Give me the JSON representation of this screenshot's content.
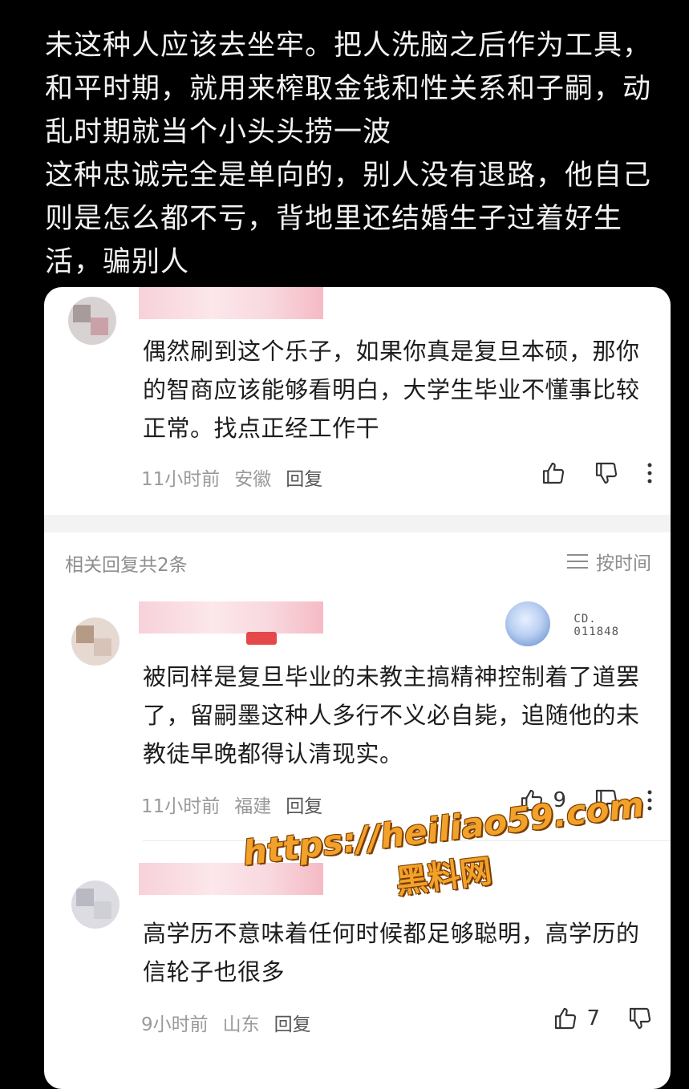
{
  "post": {
    "text": "未这种人应该去坐牢。把人洗脑之后作为工具，\n和平时期，就用来榨取金钱和性关系和子嗣，动\n乱时期就当个小头头捞一波\n这种忠诚完全是单向的，别人没有退路，他自己\n则是怎么都不亏，背地里还结婚生子过着好生\n活，骗别人"
  },
  "main_comment": {
    "body": "偶然刷到这个乐子，如果你真是复旦本硕，那你的智商应该能够看明白，大学生毕业不懂事比较正常。找点正经工作干",
    "time": "11小时前",
    "location": "安徽",
    "reply_label": "回复"
  },
  "replies_header": {
    "count_text": "相关回复共2条",
    "sort_label": "按时间"
  },
  "replies": [
    {
      "body": "被同样是复旦毕业的未教主搞精神控制着了道罢了，留嗣墨这种人多行不义必自毙，追随他的未教徒早晚都得认清现实。",
      "time": "11小时前",
      "location": "福建",
      "reply_label": "回复",
      "likes": "9",
      "medal_text": "CD.\n011848"
    },
    {
      "body": "高学历不意味着任何时候都足够聪明，高学历的信轮子也很多",
      "time": "9小时前",
      "location": "山东",
      "reply_label": "回复",
      "likes": "7"
    }
  ],
  "watermark": {
    "url": "https://heiliao59.com",
    "name": "黑料网"
  },
  "colors": {
    "background": "#000000",
    "card": "#ffffff",
    "watermark": "#f2a12a"
  },
  "icons": [
    "thumb-up-icon",
    "thumb-down-icon",
    "more-icon",
    "sort-icon"
  ]
}
